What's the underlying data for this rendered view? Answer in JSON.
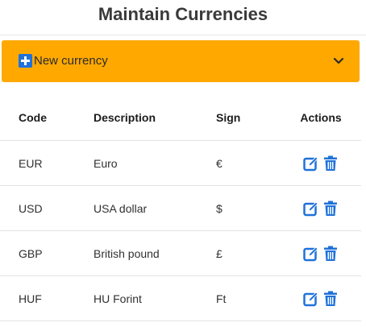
{
  "page": {
    "title": "Maintain Currencies"
  },
  "new_currency_panel": {
    "label": "New currency",
    "plus_icon": "plus-square-icon",
    "chevron_icon": "chevron-down-icon",
    "background": "#ffa800"
  },
  "table": {
    "headers": {
      "code": "Code",
      "description": "Description",
      "sign": "Sign",
      "actions": "Actions"
    },
    "rows": [
      {
        "code": "EUR",
        "description": "Euro",
        "sign": "€"
      },
      {
        "code": "USD",
        "description": "USA dollar",
        "sign": "$"
      },
      {
        "code": "GBP",
        "description": "British pound",
        "sign": "£"
      },
      {
        "code": "HUF",
        "description": "HU Forint",
        "sign": "Ft"
      }
    ],
    "edit_icon": "edit-icon",
    "delete_icon": "trash-icon",
    "icon_color": "#1f72d9"
  }
}
